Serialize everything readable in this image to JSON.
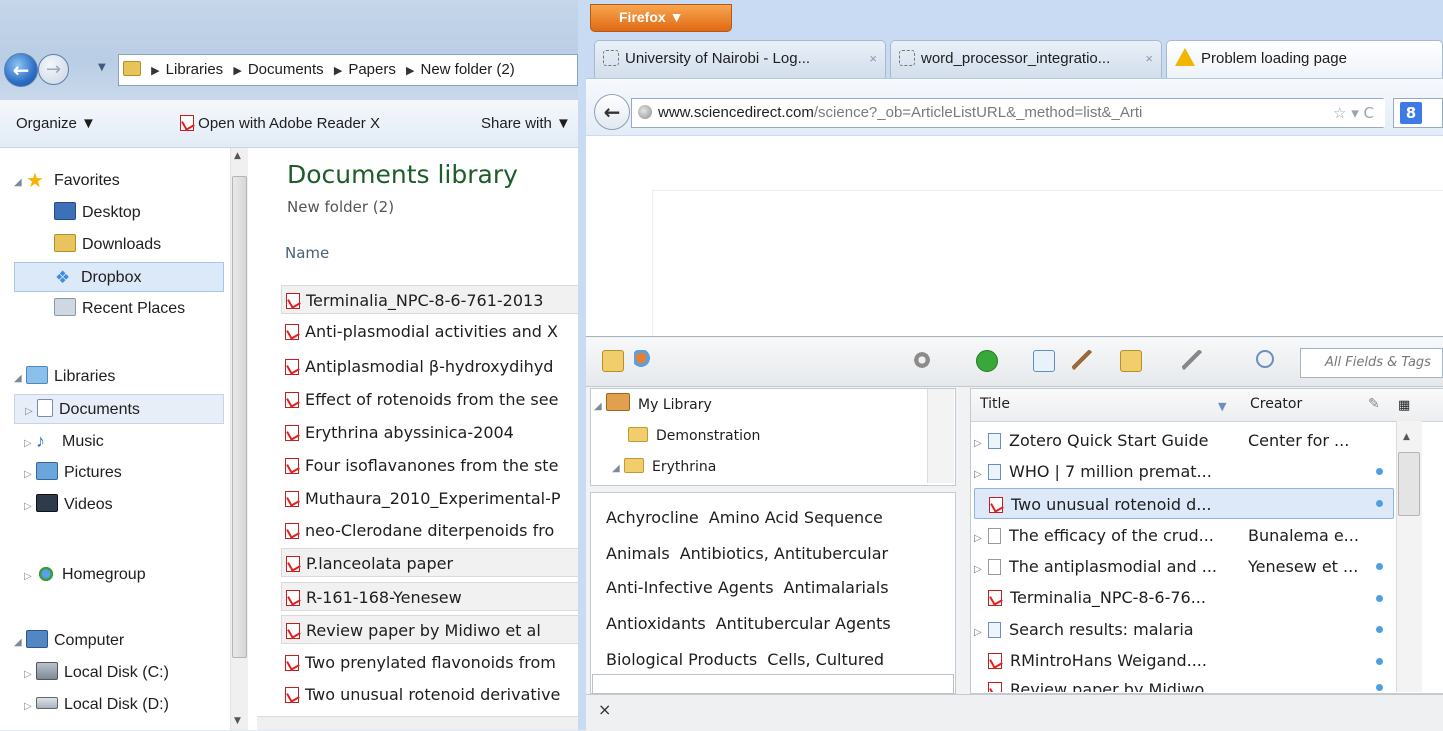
{
  "explorer": {
    "breadcrumb": [
      "Libraries",
      "Documents",
      "Papers",
      "New folder (2)"
    ],
    "toolbar": {
      "organize": "Organize ▼",
      "open_with": "Open with Adobe Reader X",
      "share_with": "Share with ▼"
    },
    "nav": {
      "favorites": "Favorites",
      "desktop": "Desktop",
      "downloads": "Downloads",
      "dropbox": "Dropbox",
      "recent_places": "Recent Places",
      "libraries": "Libraries",
      "documents": "Documents",
      "music": "Music",
      "pictures": "Pictures",
      "videos": "Videos",
      "homegroup": "Homegroup",
      "computer": "Computer",
      "local_c": "Local Disk (C:)",
      "local_d": "Local Disk (D:)"
    },
    "library_title": "Documents library",
    "library_subtitle": "New folder (2)",
    "column_name": "Name",
    "files": [
      "Terminalia_NPC-8-6-761-2013",
      "Anti-plasmodial activities and X",
      "Antiplasmodial β-hydroxydihyd",
      "Effect of rotenoids from the see",
      "Erythrina abyssinica-2004",
      "Four isoflavanones from the ste",
      "Muthaura_2010_Experimental-P",
      "neo-Clerodane diterpenoids fro",
      "P.lanceolata paper",
      "R-161-168-Yenesew",
      "Review paper by Midiwo et al",
      "Two prenylated flavonoids from",
      "Two unusual rotenoid derivative"
    ]
  },
  "firefox": {
    "menu_button": "Firefox ▼",
    "tabs": [
      {
        "label": "University of Nairobi - Log...",
        "close": "×"
      },
      {
        "label": "word_processor_integratio...",
        "close": "×"
      },
      {
        "label": "Problem loading page"
      }
    ],
    "url_host": "www.sciencedirect.com",
    "url_rest": "/science?_ob=ArticleListURL&_method=list&_Arti",
    "url_icons": "☆ ▾ C",
    "search_engine_letter": "8"
  },
  "zotero": {
    "search_placeholder": "All Fields & Tags",
    "collections": [
      "My Library",
      "Demonstration",
      "Erythrina"
    ],
    "tags": [
      [
        "Achyrocline",
        "Amino Acid Sequence"
      ],
      [
        "Animals",
        "Antibiotics, Antitubercular"
      ],
      [
        "Anti-Infective Agents",
        "Antimalarials"
      ],
      [
        "Antioxidants",
        "Antitubercular Agents"
      ],
      [
        "Biological Products",
        "Cells, Cultured"
      ]
    ],
    "columns": {
      "title": "Title",
      "creator": "Creator"
    },
    "items": [
      {
        "title": "Zotero Quick Start Guide",
        "creator": "Center for ..."
      },
      {
        "title": "WHO | 7 million premat...",
        "creator": ""
      },
      {
        "title": "Two unusual rotenoid d...",
        "creator": ""
      },
      {
        "title": "The efficacy of the crud...",
        "creator": "Bunalema e..."
      },
      {
        "title": "The antiplasmodial and ...",
        "creator": "Yenesew et ..."
      },
      {
        "title": "Terminalia_NPC-8-6-76...",
        "creator": ""
      },
      {
        "title": "Search results: malaria",
        "creator": ""
      },
      {
        "title": "RMintroHans Weigand....",
        "creator": ""
      },
      {
        "title": "Review paper by Midiwo...",
        "creator": ""
      }
    ],
    "close_label": "×"
  }
}
